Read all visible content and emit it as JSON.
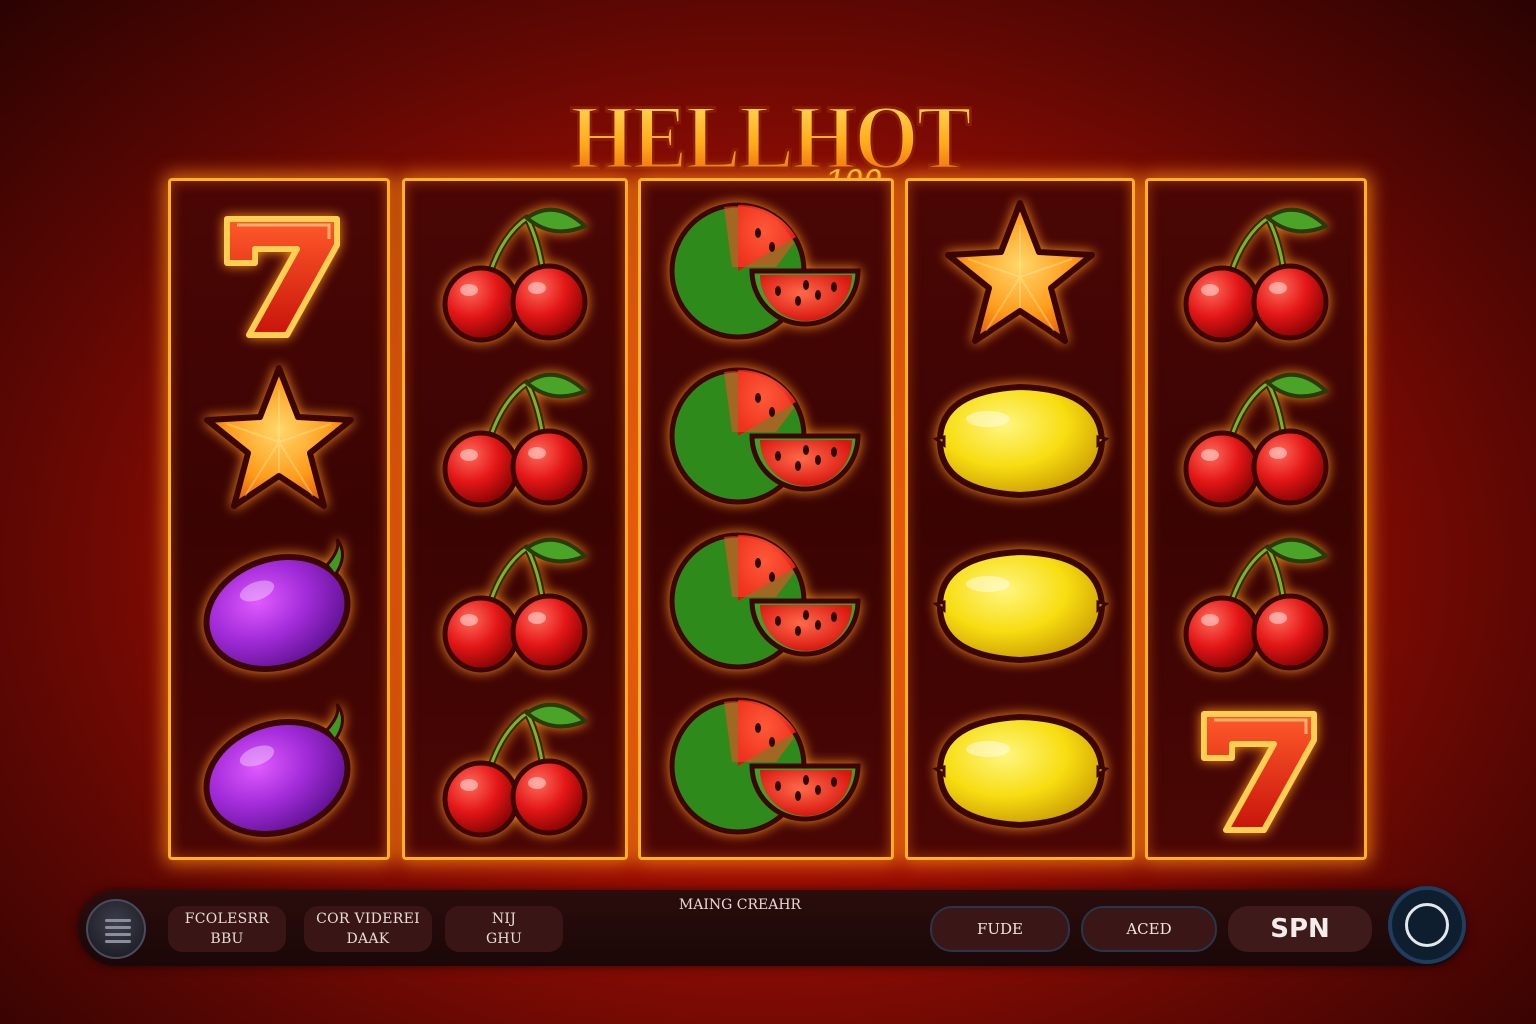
{
  "title": {
    "main": "HELLHOT",
    "badge": "100"
  },
  "reels": [
    [
      "seven",
      "star",
      "plum",
      "plum"
    ],
    [
      "cherry",
      "cherry",
      "cherry",
      "cherry"
    ],
    [
      "watermelon",
      "watermelon",
      "watermelon",
      "watermelon"
    ],
    [
      "star",
      "lemon",
      "lemon",
      "lemon"
    ],
    [
      "cherry",
      "cherry",
      "cherry",
      "seven"
    ]
  ],
  "controls": {
    "menu_icon": "hamburger-icon",
    "pill1": {
      "line1": "FCOLESRR",
      "line2": "BBU"
    },
    "pill2": {
      "line1": "COR VIDEREI",
      "line2": "DAAK"
    },
    "pill3": {
      "line1": "NIJ",
      "line2": "GHU"
    },
    "center_label": "MAING CREAHR",
    "btn_fude": "FUDE",
    "btn_aced": "ACED",
    "spin_label": "SPN",
    "autoplay_icon": "circle-icon"
  },
  "colors": {
    "reel_border": "#ffb320",
    "background": "#a50f04",
    "bar": "#1a0707"
  }
}
